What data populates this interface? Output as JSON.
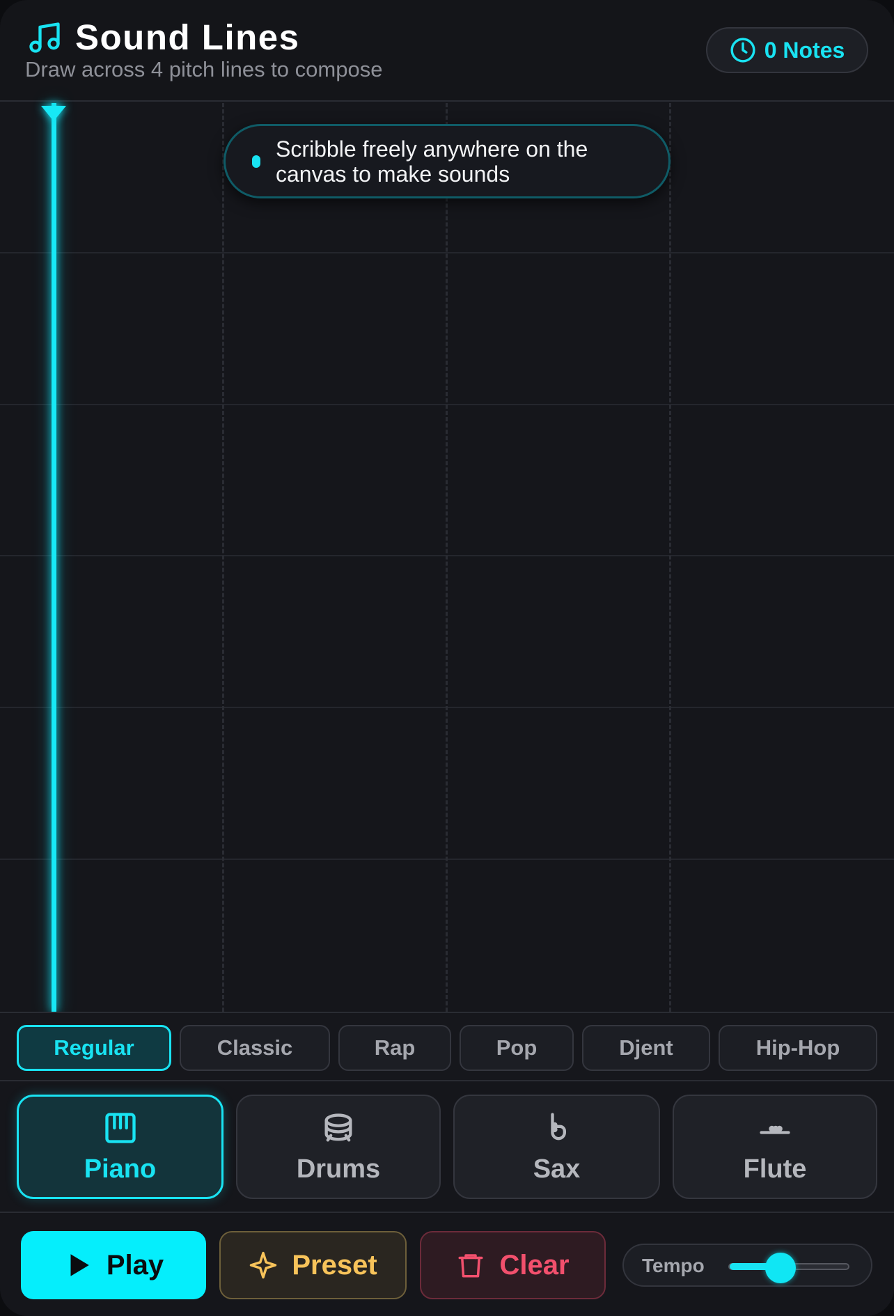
{
  "header": {
    "title": "Sound Lines",
    "subtitle": "Draw across 4 pitch lines to compose",
    "notes_label": "0 Notes"
  },
  "canvas": {
    "hint": "Scribble freely anywhere on the canvas to make sounds"
  },
  "genres": [
    {
      "label": "Regular",
      "active": true
    },
    {
      "label": "Classic",
      "active": false
    },
    {
      "label": "Rap",
      "active": false
    },
    {
      "label": "Pop",
      "active": false
    },
    {
      "label": "Djent",
      "active": false
    },
    {
      "label": "Hip-Hop",
      "active": false
    }
  ],
  "instruments": [
    {
      "label": "Piano",
      "icon": "piano-icon",
      "active": true
    },
    {
      "label": "Drums",
      "icon": "drum-icon",
      "active": false
    },
    {
      "label": "Sax",
      "icon": "sax-icon",
      "active": false
    },
    {
      "label": "Flute",
      "icon": "flute-icon",
      "active": false
    }
  ],
  "controls": {
    "play_label": "Play",
    "preset_label": "Preset",
    "clear_label": "Clear",
    "tempo_label": "Tempo",
    "tempo_fraction": 0.43
  },
  "colors": {
    "accent": "#19e3f2",
    "preset": "#f7c35a",
    "clear": "#f2506d",
    "background": "#15161b"
  }
}
